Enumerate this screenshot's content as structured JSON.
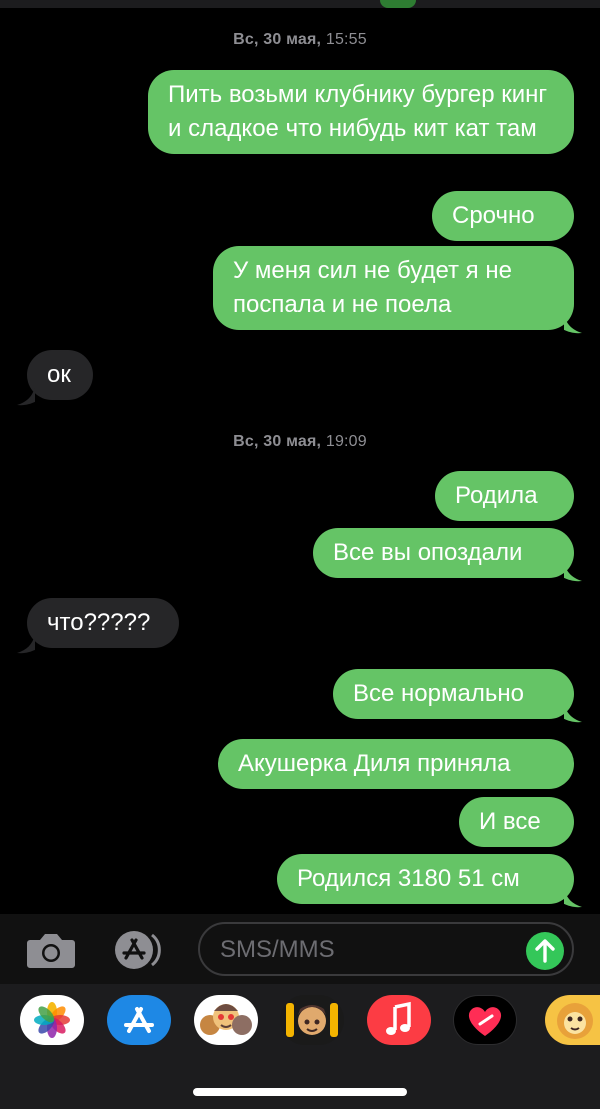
{
  "timestamps": [
    {
      "day": "Вс, 30 мая,",
      "time": "15:55"
    },
    {
      "day": "Вс, 30 мая,",
      "time": "19:09"
    }
  ],
  "messages": [
    {
      "text": "Пить возьми клубнику бургер кинг и сладкое что нибудь кит кат там",
      "direction": "outgoing"
    },
    {
      "text": "Срочно",
      "direction": "outgoing"
    },
    {
      "text": "У меня сил не будет я не поспала и не поела",
      "direction": "outgoing"
    },
    {
      "text": "ок",
      "direction": "incoming"
    },
    {
      "text": "Родила",
      "direction": "outgoing"
    },
    {
      "text": "Все вы опоздали",
      "direction": "outgoing"
    },
    {
      "text": "что?????",
      "direction": "incoming"
    },
    {
      "text": "Все нормально",
      "direction": "outgoing"
    },
    {
      "text": "Акушерка Диля приняла",
      "direction": "outgoing"
    },
    {
      "text": "И все",
      "direction": "outgoing"
    },
    {
      "text": "Родился 3180 51 см",
      "direction": "outgoing"
    }
  ],
  "composer": {
    "placeholder": "SMS/MMS",
    "camera_icon": "camera-icon",
    "apps_icon": "app-store-icon",
    "send_icon": "send-arrow-icon"
  },
  "app_drawer": [
    "photos-icon",
    "app-store-icon",
    "memoji-stickers-icon",
    "animoji-icon",
    "music-icon",
    "digital-touch-icon",
    "sticker-app-icon"
  ],
  "colors": {
    "outgoing_bubble": "#65c466",
    "incoming_bubble": "#262628",
    "background": "#000000",
    "send_button": "#34c759"
  }
}
